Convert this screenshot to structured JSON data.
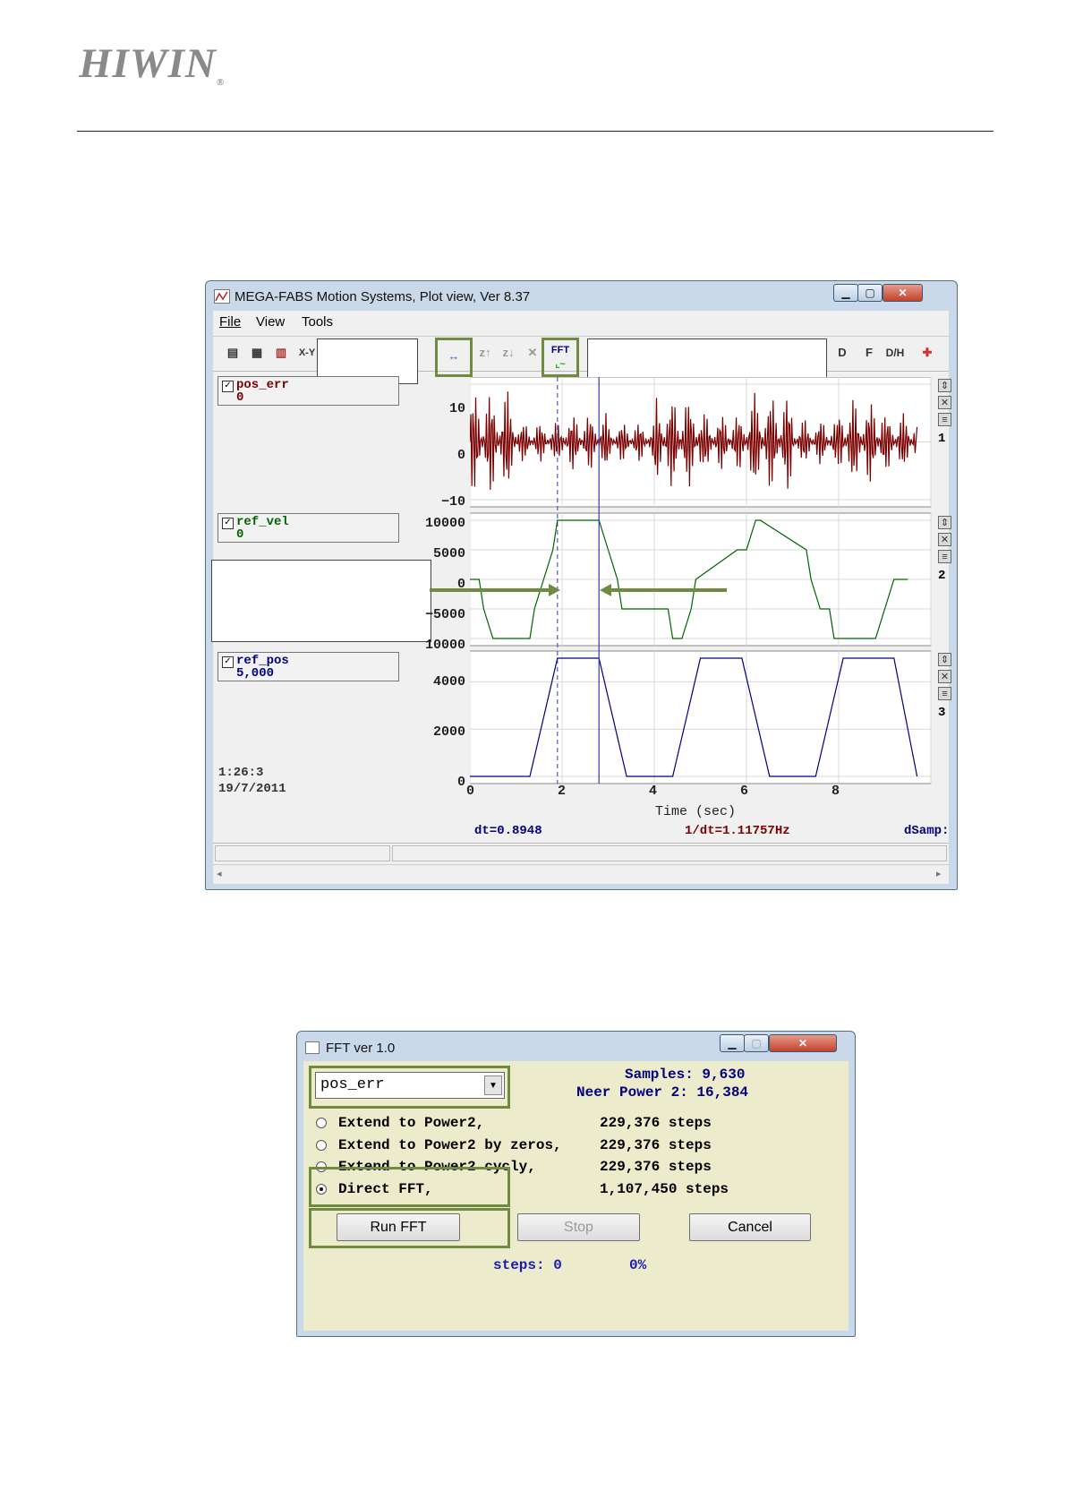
{
  "header": {
    "logo": "HIWIN",
    "logo_reg": "®"
  },
  "plot_window": {
    "title": "MEGA-FABS Motion Systems, Plot view, Ver 8.37",
    "menu": [
      "File",
      "View",
      "Tools"
    ],
    "toolbar_partial_label": "X-Y",
    "fft_button_label": "FFT",
    "toolbar_right": [
      "D",
      "F",
      "D/H"
    ],
    "channels": [
      {
        "name": "pos_err",
        "value": "0",
        "color": "#7a0000",
        "index": "1",
        "yticks": [
          "10",
          "0",
          "−10"
        ]
      },
      {
        "name": "ref_vel",
        "value": "0",
        "color": "#006400",
        "index": "2",
        "yticks": [
          "10000",
          "5000",
          "0",
          "−5000",
          "10000"
        ]
      },
      {
        "name": "ref_pos",
        "value": "5,000",
        "color": "#000080",
        "index": "3",
        "yticks": [
          "4000",
          "2000",
          "0"
        ]
      }
    ],
    "time": "1:26:3",
    "date": "19/7/2011",
    "xticks": [
      "0",
      "2",
      "4",
      "6",
      "8"
    ],
    "xlabel": "Time (sec)",
    "dt": "dt=0.8948",
    "inv_dt": "1/dt=1.11757Hz",
    "dsamp": "dSamp:"
  },
  "fft_window": {
    "title": "FFT ver 1.0",
    "selected_signal": "pos_err",
    "samples": "Samples: 9,630",
    "neer_power": "Neer Power 2: 16,384",
    "options": [
      {
        "label": "Extend to Power2,",
        "steps": "229,376 steps",
        "selected": false
      },
      {
        "label": "Extend to Power2 by zeros,",
        "steps": "229,376 steps",
        "selected": false
      },
      {
        "label": "Extend to Power2 cycly,",
        "steps": "229,376 steps",
        "selected": false
      },
      {
        "label": "Direct FFT,",
        "steps": "1,107,450 steps",
        "selected": true
      }
    ],
    "run_label": "Run FFT",
    "stop_label": "Stop",
    "cancel_label": "Cancel",
    "status_steps": "steps: 0",
    "status_percent": "0%"
  },
  "chart_data": [
    {
      "type": "line",
      "series": [
        {
          "name": "pos_err"
        }
      ],
      "ylim": [
        -10,
        10
      ],
      "xlim": [
        0,
        10
      ],
      "xlabel": "Time (sec)",
      "description_values": "oscillating signal, amplitude up to about ±10"
    },
    {
      "type": "line",
      "series": [
        {
          "name": "ref_vel"
        }
      ],
      "ylim": [
        -10000,
        10000
      ],
      "xlim": [
        0,
        10
      ],
      "xlabel": "Time (sec)",
      "x": [
        0,
        0.2,
        0.3,
        0.5,
        1.3,
        1.4,
        1.6,
        1.8,
        1.9,
        2.8,
        3.0,
        3.2,
        3.3,
        4.3,
        4.4,
        4.6,
        4.8,
        4.9,
        5.8,
        6.0,
        6.2,
        6.3,
        7.3,
        7.4,
        7.6,
        7.8,
        7.9,
        8.8,
        9.0,
        9.2,
        9.3,
        9.5
      ],
      "y": [
        0,
        0,
        -5000,
        -10000,
        -10000,
        -5000,
        0,
        5000,
        10000,
        10000,
        5000,
        0,
        -5000,
        -5000,
        -10000,
        -10000,
        -5000,
        0,
        5000,
        5000,
        10000,
        10000,
        5000,
        0,
        -5000,
        -5000,
        -10000,
        -10000,
        -5000,
        0,
        0,
        0
      ]
    },
    {
      "type": "line",
      "series": [
        {
          "name": "ref_pos"
        }
      ],
      "ylim": [
        0,
        5000
      ],
      "xlim": [
        0,
        10
      ],
      "xlabel": "Time (sec)",
      "x": [
        0,
        0.2,
        0.8,
        1.3,
        1.9,
        2.8,
        3.4,
        4.4,
        5.0,
        5.9,
        6.5,
        7.5,
        8.1,
        9.2,
        9.7
      ],
      "y": [
        0,
        0,
        0,
        0,
        5000,
        5000,
        0,
        0,
        5000,
        5000,
        0,
        0,
        5000,
        5000,
        0
      ]
    }
  ]
}
